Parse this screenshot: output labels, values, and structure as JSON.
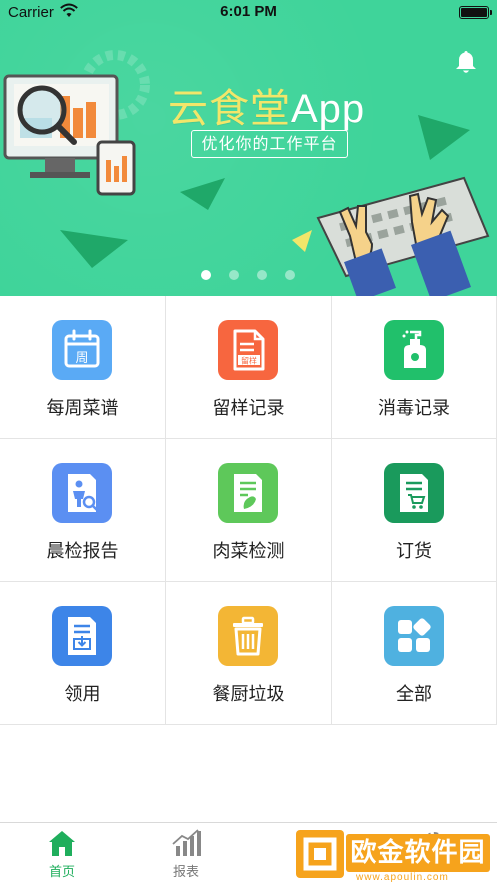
{
  "status_bar": {
    "carrier": "Carrier",
    "time": "6:01 PM"
  },
  "banner": {
    "title_main": "云食堂",
    "title_app": "App",
    "subtitle": "优化你的工作平台",
    "page_count": 4,
    "active_page": 1,
    "background_color": "#3fd49a"
  },
  "grid": {
    "items": [
      {
        "label": "每周菜谱",
        "icon": "calendar-icon",
        "icon_text": "周",
        "color": "#5aaaf5"
      },
      {
        "label": "留样记录",
        "icon": "sample-doc-icon",
        "icon_text": "留样",
        "color": "#f7663f"
      },
      {
        "label": "消毒记录",
        "icon": "sanitizer-bottle-icon",
        "color": "#21c06b"
      },
      {
        "label": "晨检报告",
        "icon": "person-report-icon",
        "color": "#5b8ff2"
      },
      {
        "label": "肉菜检测",
        "icon": "vegetable-doc-icon",
        "color": "#5ec85a"
      },
      {
        "label": "订货",
        "icon": "cart-doc-icon",
        "color": "#1a9a5c"
      },
      {
        "label": "领用",
        "icon": "receive-doc-icon",
        "color": "#3d85e8"
      },
      {
        "label": "餐厨垃圾",
        "icon": "trash-icon",
        "color": "#f3b635"
      },
      {
        "label": "全部",
        "icon": "all-apps-icon",
        "color": "#4fb1e0"
      }
    ]
  },
  "tabbar": {
    "tabs": [
      {
        "label": "首页",
        "icon": "home-icon",
        "active": true
      },
      {
        "label": "报表",
        "icon": "chart-icon",
        "active": false
      },
      {
        "label": "",
        "icon": "device-icon",
        "active": false
      },
      {
        "label": "",
        "icon": "settings-icon",
        "active": false
      }
    ],
    "active_color": "#1fae5c"
  },
  "watermark": {
    "text": "欧金软件园",
    "url": "www.apoulin.com"
  }
}
